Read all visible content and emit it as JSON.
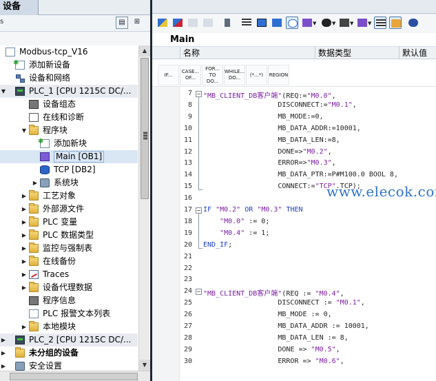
{
  "left_panel": {
    "tab_title": "设备",
    "toolbar_prefix": "s",
    "tree": [
      {
        "label": "Modbus-tcp_V16",
        "icon": "project-doc-icon",
        "twisty": "",
        "level": 0
      },
      {
        "label": "添加新设备",
        "icon": "add-device-icon",
        "twisty": "",
        "level": 1
      },
      {
        "label": "设备和网络",
        "icon": "devices-networks-icon",
        "twisty": "",
        "level": 1
      },
      {
        "label": "PLC_1 [CPU 1215C DC/...",
        "icon": "plc-icon",
        "twisty": "▼",
        "level": 0,
        "plc": true
      },
      {
        "label": "设备组态",
        "icon": "device-config-icon",
        "twisty": "",
        "level": 2
      },
      {
        "label": "在线和诊断",
        "icon": "online-diagnostics-icon",
        "twisty": "",
        "level": 2
      },
      {
        "label": "程序块",
        "icon": "folder-icon",
        "twisty": "▼",
        "level": 2
      },
      {
        "label": "添加新块",
        "icon": "add-block-icon",
        "twisty": "",
        "level": 3
      },
      {
        "label": "Main [OB1]",
        "icon": "ob-block-icon",
        "twisty": "",
        "level": 3,
        "selected": true
      },
      {
        "label": "TCP [DB2]",
        "icon": "db-block-icon",
        "twisty": "",
        "level": 3
      },
      {
        "label": "系统块",
        "icon": "system-blocks-icon",
        "twisty": "▶",
        "level": 3
      },
      {
        "label": "工艺对象",
        "icon": "folder-icon",
        "twisty": "▶",
        "level": 2
      },
      {
        "label": "外部源文件",
        "icon": "folder-icon",
        "twisty": "▶",
        "level": 2
      },
      {
        "label": "PLC 变量",
        "icon": "folder-icon",
        "twisty": "▶",
        "level": 2
      },
      {
        "label": "PLC 数据类型",
        "icon": "folder-icon",
        "twisty": "▶",
        "level": 2
      },
      {
        "label": "监控与强制表",
        "icon": "folder-icon",
        "twisty": "▶",
        "level": 2
      },
      {
        "label": "在线备份",
        "icon": "folder-icon",
        "twisty": "▶",
        "level": 2
      },
      {
        "label": "Traces",
        "icon": "traces-icon",
        "twisty": "▶",
        "level": 2
      },
      {
        "label": "设备代理数据",
        "icon": "folder-icon",
        "twisty": "▶",
        "level": 2
      },
      {
        "label": "程序信息",
        "icon": "program-info-icon",
        "twisty": "",
        "level": 2
      },
      {
        "label": "PLC 报警文本列表",
        "icon": "alarm-text-icon",
        "twisty": "",
        "level": 2
      },
      {
        "label": "本地模块",
        "icon": "folder-icon",
        "twisty": "▶",
        "level": 2
      },
      {
        "label": "PLC_2 [CPU 1215C DC/...",
        "icon": "plc-icon",
        "twisty": "▶",
        "level": 0,
        "plc": true
      },
      {
        "label": "未分组的设备",
        "icon": "folder-icon",
        "twisty": "▶",
        "level": 0,
        "bold": true
      },
      {
        "label": "安全设置",
        "icon": "security-icon",
        "twisty": "▶",
        "level": 0
      }
    ]
  },
  "editor": {
    "block_title": "Main",
    "interface_columns": [
      "名称",
      "数据类型",
      "默认值"
    ],
    "instructions": [
      {
        "label": "IF...",
        "name": "instr-if"
      },
      {
        "label": "CASE... OF...",
        "name": "instr-case"
      },
      {
        "label": "FOR... TO DO...",
        "name": "instr-for"
      },
      {
        "label": "WHILE... DO...",
        "name": "instr-while"
      },
      {
        "label": "(*...*)",
        "name": "instr-comment"
      },
      {
        "label": "REGION",
        "name": "instr-region"
      }
    ],
    "code_lines": [
      {
        "n": "7",
        "fold": "-",
        "text": "\"MB_CLIENT_DB客户端\"(REQ:=\"M0.0\","
      },
      {
        "n": "8",
        "text": "                  DISCONNECT:=\"M0.1\","
      },
      {
        "n": "9",
        "text": "                  MB_MODE:=0,"
      },
      {
        "n": "10",
        "text": "                  MB_DATA_ADDR:=10001,"
      },
      {
        "n": "11",
        "text": "                  MB_DATA_LEN:=8,"
      },
      {
        "n": "12",
        "text": "                  DONE=>\"M0.2\","
      },
      {
        "n": "13",
        "text": "                  ERROR=>\"M0.3\","
      },
      {
        "n": "14",
        "text": "                  MB_DATA_PTR:=P#M100.0 BOOL 8,"
      },
      {
        "n": "15",
        "text": "                  CONNECT:=\"TCP\".TCP);"
      },
      {
        "n": "16",
        "text": ""
      },
      {
        "n": "17",
        "fold": "-",
        "text": "IF \"M0.2\" OR \"M0.3\" THEN"
      },
      {
        "n": "18",
        "text": "    \"M0.0\" := 0;"
      },
      {
        "n": "19",
        "text": "    \"M0.4\" := 1;"
      },
      {
        "n": "20",
        "text": "END_IF;"
      },
      {
        "n": "21",
        "text": ""
      },
      {
        "n": "22",
        "text": ""
      },
      {
        "n": "23",
        "text": ""
      },
      {
        "n": "24",
        "fold": "-",
        "text": "\"MB_CLIENT_DB客户端\"(REQ := \"M0.4\","
      },
      {
        "n": "25",
        "text": "                  DISCONNECT := \"M0.1\","
      },
      {
        "n": "26",
        "text": "                  MB_MODE := 0,"
      },
      {
        "n": "27",
        "text": "                  MB_DATA_ADDR := 10001,"
      },
      {
        "n": "28",
        "text": "                  MB_DATA_LEN := 8,"
      },
      {
        "n": "29",
        "text": "                  DONE => \"M0.5\","
      },
      {
        "n": "30",
        "text": "                  ERROR => \"M0.6\","
      }
    ]
  },
  "watermark": "www.elecok.com"
}
